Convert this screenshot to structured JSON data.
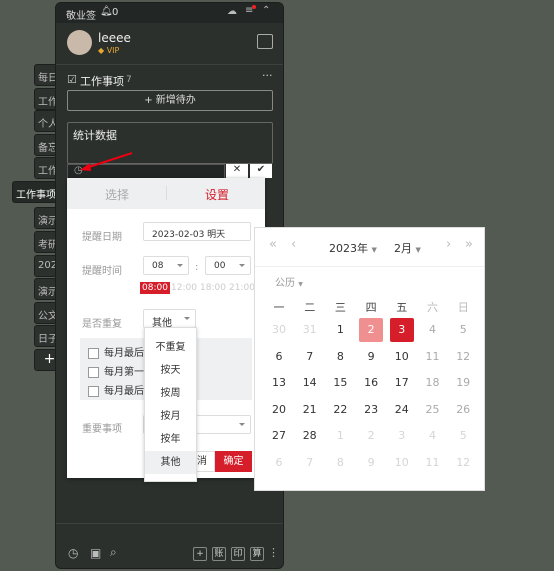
{
  "side_tabs": [
    "每日",
    "工作",
    "个人",
    "备忘",
    "工作",
    "工作事项",
    "演示",
    "考研",
    "202",
    "演示",
    "公文",
    "日子"
  ],
  "side_add": "+",
  "topbar": {
    "title": "敬业签",
    "bell_count": "0"
  },
  "user": {
    "name": "leeee",
    "badge": "VIP"
  },
  "list": {
    "title": "工作事项",
    "count": "7",
    "add_label": "+ 新增待办"
  },
  "editor": {
    "text": "统计数据"
  },
  "popup": {
    "tabs": [
      "选择",
      "设置"
    ],
    "date_label": "提醒日期",
    "date_value": "2023-02-03 明天",
    "time_label": "提醒时间",
    "hour": "08",
    "minute": "00",
    "sep": ":",
    "quick_times": [
      "08:00",
      "12:00",
      "18:00",
      "21:00"
    ],
    "repeat_label": "是否重复",
    "repeat_value": "其他",
    "options": [
      "每月最后一",
      "每月第一个",
      "每月最后一"
    ],
    "important_label": "重要事项",
    "cancel": "取消",
    "confirm": "确定"
  },
  "dropdown": [
    "不重复",
    "按天",
    "按周",
    "按月",
    "按年",
    "其他"
  ],
  "calendar": {
    "year": "2023年",
    "month": "2月",
    "mode": "公历",
    "weekdays": [
      "一",
      "二",
      "三",
      "四",
      "五",
      "六",
      "日"
    ],
    "days": [
      [
        "30",
        "31",
        "1",
        "2",
        "3",
        "4",
        "5"
      ],
      [
        "6",
        "7",
        "8",
        "9",
        "10",
        "11",
        "12"
      ],
      [
        "13",
        "14",
        "15",
        "16",
        "17",
        "18",
        "19"
      ],
      [
        "20",
        "21",
        "22",
        "23",
        "24",
        "25",
        "26"
      ],
      [
        "27",
        "28",
        "1",
        "2",
        "3",
        "4",
        "5"
      ],
      [
        "6",
        "7",
        "8",
        "9",
        "10",
        "11",
        "12"
      ]
    ],
    "today": "2",
    "selected": "3"
  },
  "footer": {
    "buttons": [
      "+",
      "账",
      "印",
      "算"
    ]
  },
  "colors": {
    "accent": "#d51e2a",
    "today": "#f08f8f"
  }
}
